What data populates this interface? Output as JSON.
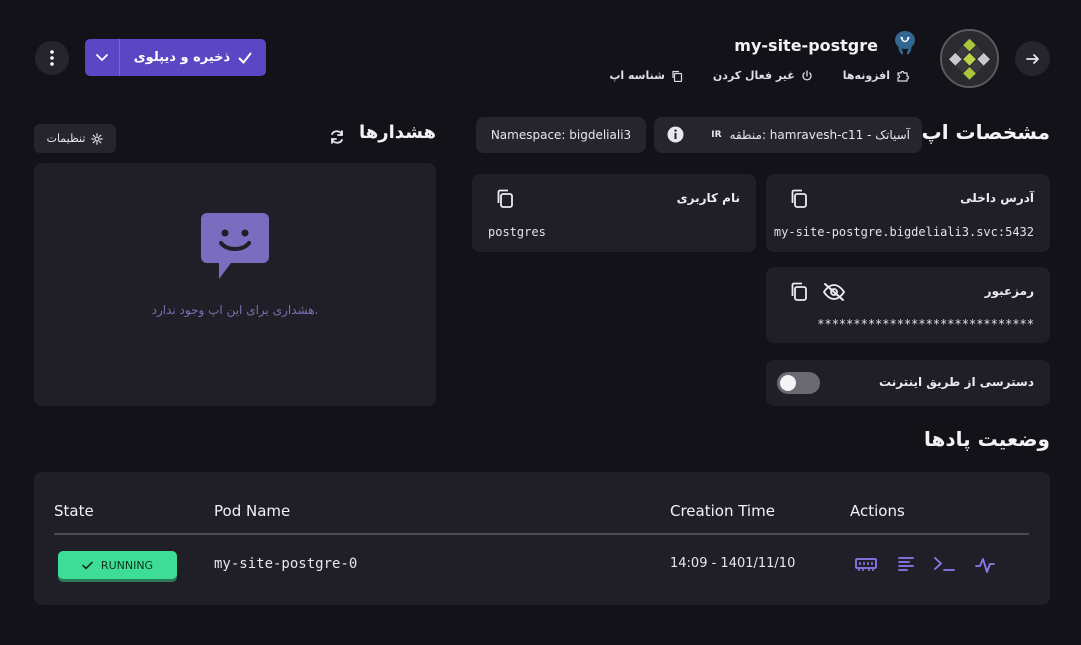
{
  "header": {
    "app_name": "my-site-postgre",
    "links": {
      "app_id": "شناسه اپ",
      "disable": "غیر فعال کردن",
      "addons": "افزونه‌ها"
    },
    "deploy_label": "ذخیره و دیپلوی"
  },
  "spec": {
    "title": "مشخصات اپ",
    "region": "منطقه: hamravesh-c11 - آسیاتک",
    "region_badge": "IR",
    "namespace": "Namespace: bigdeliali3",
    "internal_address_label": "آدرس داخلی",
    "internal_address_value": "my-site-postgre.bigdeliali3.svc:5432",
    "username_label": "نام کاربری",
    "username_value": "postgres",
    "password_label": "رمزعبور",
    "password_value": "******************************",
    "internet_access_label": "دسترسی از طریق اینترنت",
    "internet_access_enabled": false
  },
  "alerts": {
    "title": "هشدارها",
    "settings_label": "تنظیمات",
    "empty_text": "هشداری برای این اپ وجود ندارد."
  },
  "pods": {
    "title": "وضعیت پادها",
    "columns": [
      "State",
      "Pod Name",
      "Creation Time",
      "Actions"
    ],
    "rows": [
      {
        "state": "RUNNING",
        "name": "my-site-postgre-0",
        "created": "14:09 - 1401/11/10"
      }
    ]
  },
  "colors": {
    "accent": "#5b46c4",
    "running": "#3ddc97",
    "icon_purple": "#8b7cf0"
  },
  "icons": [
    "arrow-right-icon",
    "postgres-icon",
    "copy-icon",
    "power-icon",
    "puzzle-icon",
    "check-icon",
    "chevron-down-icon",
    "kebab-icon",
    "refresh-icon",
    "gear-icon",
    "chat-smile-icon",
    "info-icon",
    "eye-off-icon",
    "memory-icon",
    "logs-icon",
    "terminal-icon",
    "pulse-icon"
  ]
}
